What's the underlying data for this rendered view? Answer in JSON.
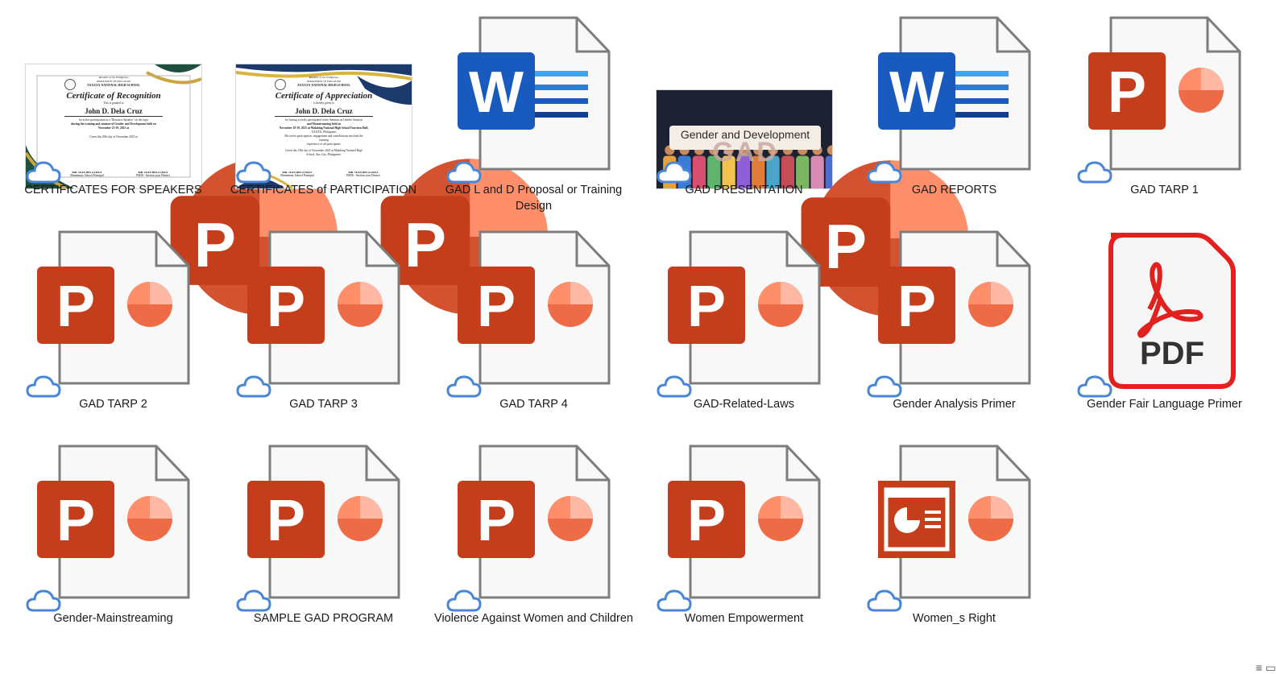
{
  "window": {
    "view_icon": "≡ ▭"
  },
  "colors": {
    "word_blue": "#185ABD",
    "ppt_red": "#C43E1C",
    "pdf_red": "#E2201E",
    "cloud_blue": "#4A86D8"
  },
  "files": [
    {
      "name": "CERTIFICATES FOR SPEAKERS",
      "kind": "cert",
      "icon": "certificate-thumbnail",
      "thumb": {
        "republic": "Republic of the Philippines",
        "dept": "DEPARTMENT OF EDUCATION",
        "school": "XXXXXX NATIONAL HIGH SCHOOL",
        "title": "Certificate of Recognition",
        "granted": "This is granted to",
        "recipient": "John D. Dela Cruz",
        "body1": "for active participation as a \"Resource Speaker\" on the topic",
        "body2": "during the training and seminar of Gender and Development held on",
        "body3": "November 25-29, 2025 at",
        "given": "Given this 29th day of November 2025 at",
        "sig1": "MR. JUAN DELA CRUZ",
        "sig1_role": "Elementary School Principal",
        "sig2": "MR. JUAN DELA CRUZ",
        "sig2_role": "PSDS - Section your District"
      }
    },
    {
      "name": "CERTIFICATES of PARTICIPATION",
      "kind": "cert2",
      "icon": "certificate-thumbnail",
      "thumb": {
        "republic": "Republic of the Philippines",
        "dept": "DEPARTMENT OF EDUCATION",
        "school": "XXXXXX NATIONAL HIGH SCHOOL",
        "title": "Certificate of Appreciation",
        "granted": "is hereby given to",
        "recipient": "John D. Dela Cruz",
        "body1": "for having actively participated in the Seminar on Gender Analysis",
        "body2": "and Mainstreaming held on",
        "body3": "November 18-19, 2025 at Malaking National High School Function Hall,",
        "body4": "XXXXX, Philippines",
        "body5": "His active participation, engagement and contributions enriched the",
        "body6": "learning",
        "body7": "experience of all participants.",
        "given": "Given this 19th day of November 2025 at Malaking National High",
        "given2": "School, Any City, Philippines.",
        "sig1": "MR. JUAN DELA CRUZ",
        "sig1_role": "Elementary School Principal",
        "sig2": "MR. JUAN DELA CRUZ",
        "sig2_role": "PSDS - Section your District"
      }
    },
    {
      "name": "GAD L and D Proposal or Training Design",
      "kind": "word",
      "icon": "word-document-icon"
    },
    {
      "name": "GAD PRESENTATION",
      "kind": "gad",
      "icon": "gad-presentation-thumbnail",
      "thumb": {
        "title": "Gender and Development",
        "abbr": "GAD"
      }
    },
    {
      "name": "GAD REPORTS",
      "kind": "word",
      "icon": "word-document-icon"
    },
    {
      "name": "GAD TARP 1",
      "kind": "ppt",
      "icon": "powerpoint-document-icon"
    },
    {
      "name": "GAD TARP 2",
      "kind": "ppt",
      "icon": "powerpoint-document-icon"
    },
    {
      "name": "GAD TARP 3",
      "kind": "ppt",
      "icon": "powerpoint-document-icon"
    },
    {
      "name": "GAD TARP 4",
      "kind": "ppt",
      "icon": "powerpoint-document-icon"
    },
    {
      "name": "GAD-Related-Laws",
      "kind": "ppt",
      "icon": "powerpoint-document-icon"
    },
    {
      "name": "Gender Analysis Primer",
      "kind": "ppt",
      "icon": "powerpoint-document-icon"
    },
    {
      "name": "Gender Fair Language Primer",
      "kind": "pdf",
      "icon": "pdf-document-icon",
      "badge": "PDF"
    },
    {
      "name": "Gender-Mainstreaming",
      "kind": "ppt",
      "icon": "powerpoint-document-icon"
    },
    {
      "name": "SAMPLE GAD PROGRAM",
      "kind": "ppt",
      "icon": "powerpoint-document-icon"
    },
    {
      "name": "Violence Against Women and Children",
      "kind": "ppt",
      "icon": "powerpoint-document-icon"
    },
    {
      "name": "Women Empowerment",
      "kind": "ppt",
      "icon": "powerpoint-document-icon"
    },
    {
      "name": "Women_s Right",
      "kind": "pptshow",
      "icon": "powerpoint-show-icon"
    }
  ]
}
